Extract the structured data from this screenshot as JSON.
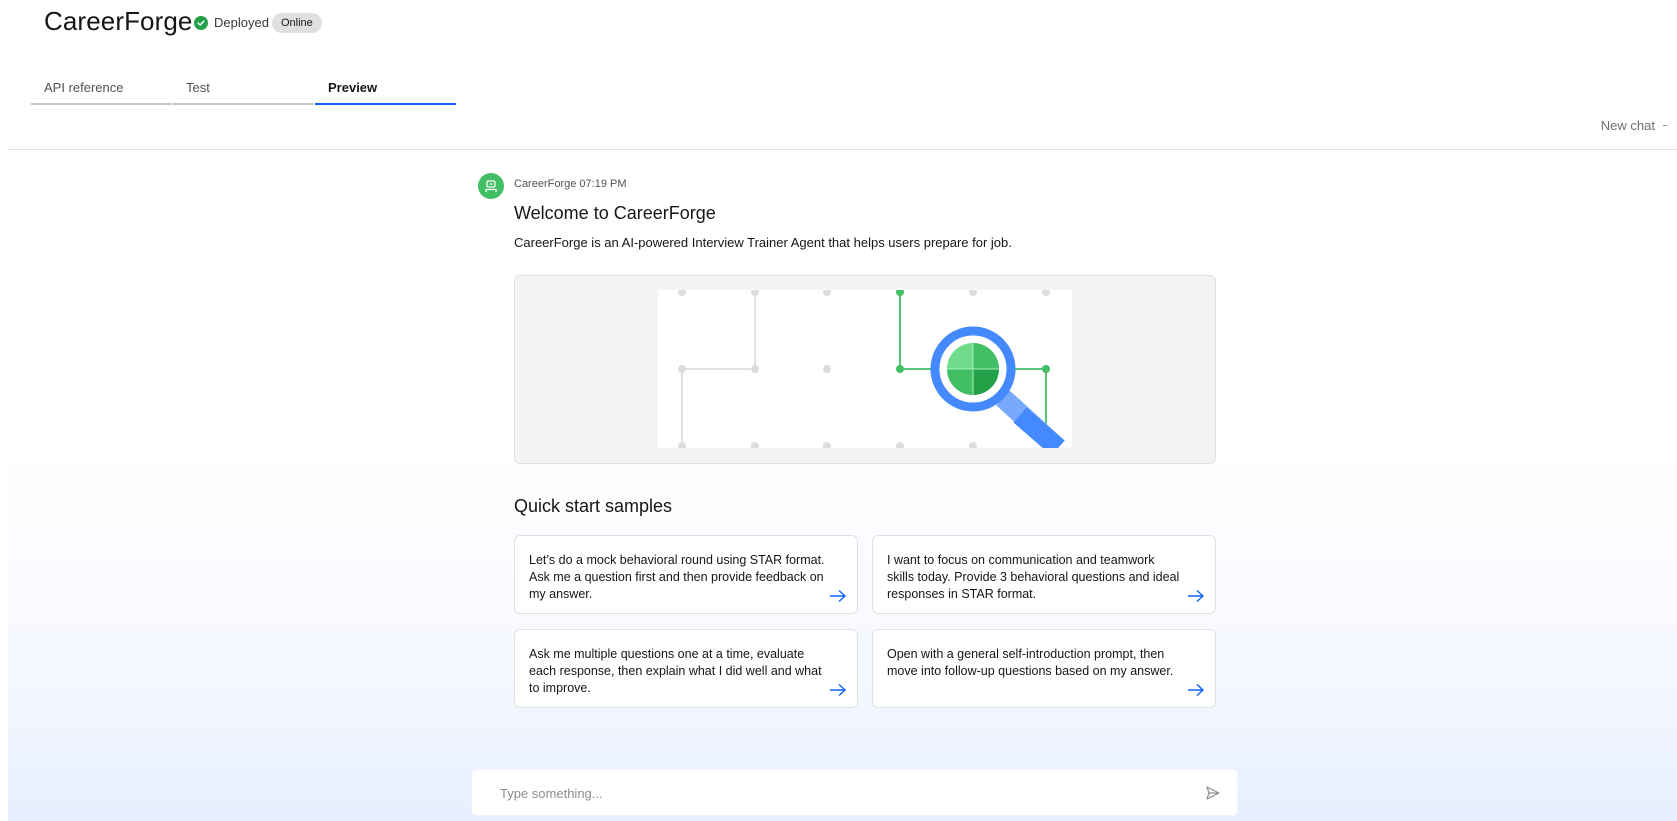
{
  "app": {
    "title": "CareerForge",
    "status_label": "Deployed",
    "badge": "Online"
  },
  "tabs": [
    {
      "label": "API reference",
      "active": false
    },
    {
      "label": "Test",
      "active": false
    },
    {
      "label": "Preview",
      "active": true
    }
  ],
  "toolbar": {
    "new_chat_label": "New chat"
  },
  "message": {
    "sender": "CareerForge",
    "time": "07:19 PM",
    "title": "Welcome to CareerForge",
    "description": "CareerForge is an AI-powered Interview Trainer Agent that helps users prepare for job."
  },
  "samples": {
    "title": "Quick start samples",
    "items": [
      {
        "text": "Let’s do a mock behavioral round using STAR format. Ask me a question first and then provide feedback on my answer."
      },
      {
        "text": "I want to focus on communication and teamwork skills today. Provide 3 behavioral questions and ideal responses in STAR format."
      },
      {
        "text": "Ask me multiple questions one at a time, evaluate each response, then explain what I did well and what to improve."
      },
      {
        "text": "Open with a general self-introduction prompt, then move into follow-up questions based on my answer."
      }
    ]
  },
  "input": {
    "placeholder": "Type something..."
  },
  "icons": {
    "status": "check-circle-icon",
    "avatar": "robot-icon",
    "sample_arrow": "arrow-right-icon",
    "send": "send-icon",
    "illustration": "magnifier-network-icon"
  },
  "colors": {
    "accent": "#0f62fe",
    "success": "#24a148",
    "avatar": "#42be65"
  }
}
